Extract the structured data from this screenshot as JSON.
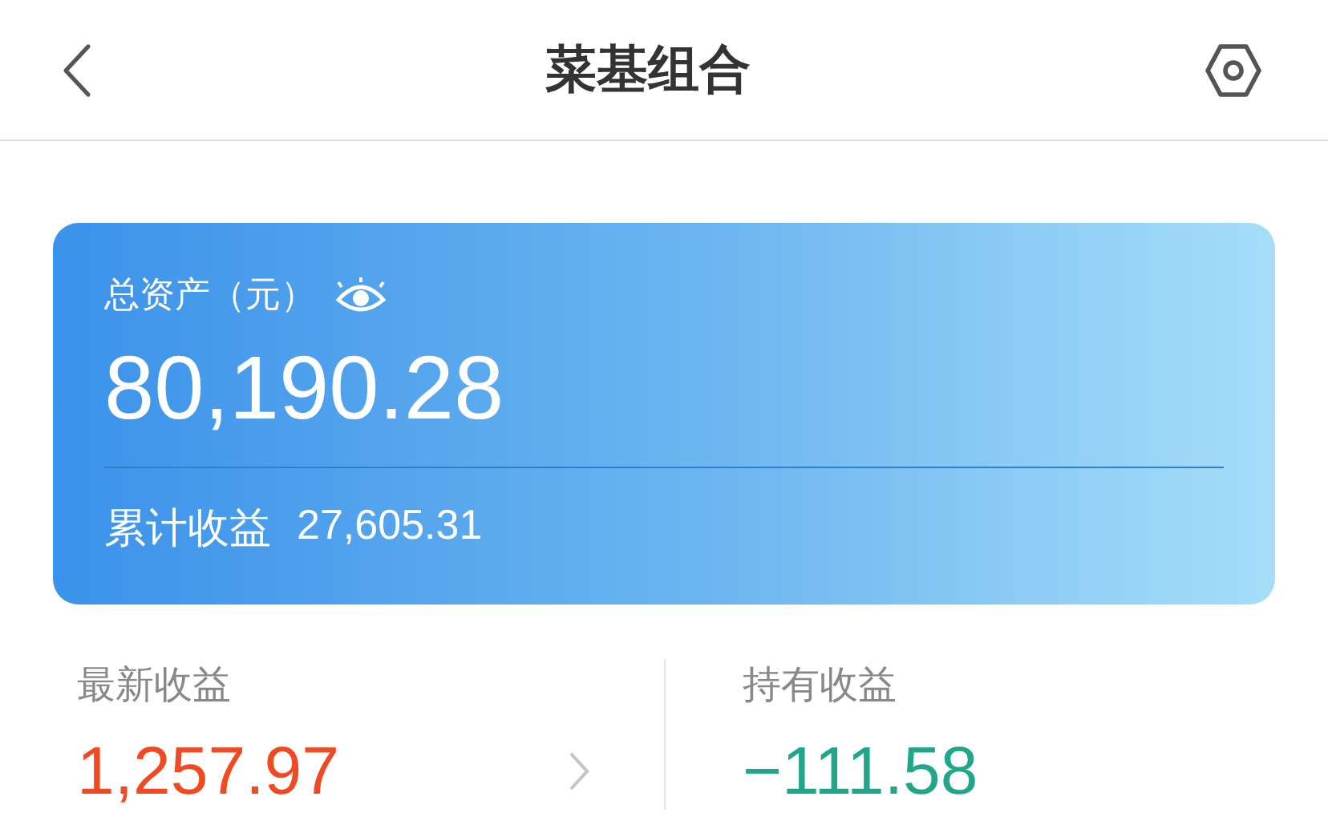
{
  "header": {
    "title": "菜基组合"
  },
  "asset_card": {
    "label": "总资产（元）",
    "total": "80,190.28",
    "cumulative_label": "累计收益",
    "cumulative_value": "27,605.31"
  },
  "stats": [
    {
      "label": "最新收益",
      "value": "1,257.97",
      "color": "#f04a23",
      "has_arrow": true
    },
    {
      "label": "持有收益",
      "value": "−111.58",
      "color": "#21a68a",
      "has_arrow": false
    }
  ]
}
